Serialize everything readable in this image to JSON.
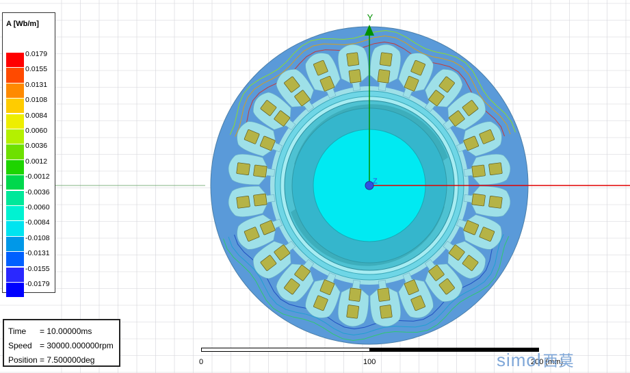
{
  "legend": {
    "title": "A [Wb/m]",
    "entries": [
      {
        "value": "0.0179",
        "color": "#ff0000"
      },
      {
        "value": "0.0155",
        "color": "#ff4a00"
      },
      {
        "value": "0.0131",
        "color": "#ff8a00"
      },
      {
        "value": "0.0108",
        "color": "#ffcc00"
      },
      {
        "value": "0.0084",
        "color": "#eeee00"
      },
      {
        "value": "0.0060",
        "color": "#b4f000"
      },
      {
        "value": "0.0036",
        "color": "#6ee000"
      },
      {
        "value": "0.0012",
        "color": "#1ed400"
      },
      {
        "value": "-0.0012",
        "color": "#00d84c"
      },
      {
        "value": "-0.0036",
        "color": "#00e89a"
      },
      {
        "value": "-0.0060",
        "color": "#00f2d2"
      },
      {
        "value": "-0.0084",
        "color": "#00e4f0"
      },
      {
        "value": "-0.0108",
        "color": "#0098e8"
      },
      {
        "value": "-0.0131",
        "color": "#0060ff"
      },
      {
        "value": "-0.0155",
        "color": "#2a28ff"
      },
      {
        "value": "-0.0179",
        "color": "#0000ff"
      }
    ]
  },
  "info": {
    "time_label": "Time",
    "time_value": "= 10.00000ms",
    "speed_label": "Speed",
    "speed_value": "= 30000.000000rpm",
    "position_label": "Position",
    "position_value": "= 7.500000deg"
  },
  "scale": {
    "tick0": "0",
    "tick1": "100",
    "tick2": "200 (mm)"
  },
  "axes": {
    "y_label": "Y",
    "z_label": "Z"
  },
  "logo": {
    "latin": "simol",
    "chinese": "西莫"
  },
  "colors": {
    "stator": "#5a9ad9",
    "slot_region": "#9ee0e8",
    "coil": "#b5b346",
    "rotor_outer": "#4ec2d2",
    "rotor_core": "#35b6cc",
    "shaft": "#00eaf2",
    "grid": "#d2d2d8",
    "axis_x": "#e00000",
    "axis_y": "#009000"
  }
}
